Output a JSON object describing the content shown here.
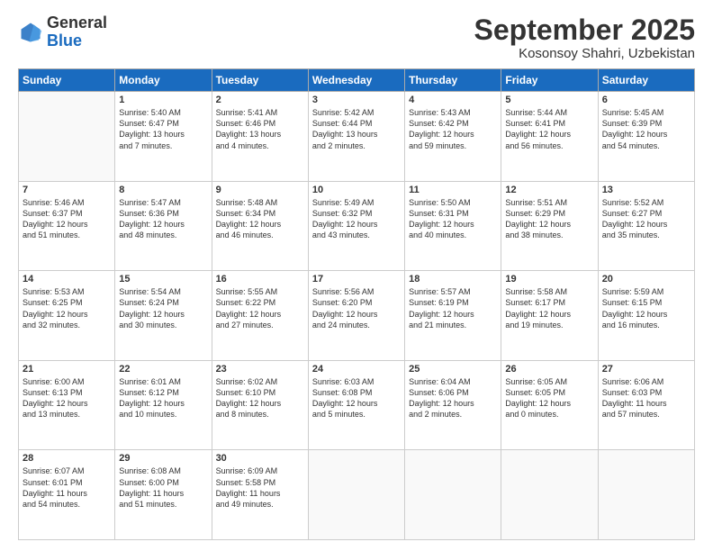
{
  "logo": {
    "general": "General",
    "blue": "Blue"
  },
  "header": {
    "month": "September 2025",
    "location": "Kosonsoy Shahri, Uzbekistan"
  },
  "weekdays": [
    "Sunday",
    "Monday",
    "Tuesday",
    "Wednesday",
    "Thursday",
    "Friday",
    "Saturday"
  ],
  "weeks": [
    [
      {
        "day": "",
        "info": ""
      },
      {
        "day": "1",
        "info": "Sunrise: 5:40 AM\nSunset: 6:47 PM\nDaylight: 13 hours\nand 7 minutes."
      },
      {
        "day": "2",
        "info": "Sunrise: 5:41 AM\nSunset: 6:46 PM\nDaylight: 13 hours\nand 4 minutes."
      },
      {
        "day": "3",
        "info": "Sunrise: 5:42 AM\nSunset: 6:44 PM\nDaylight: 13 hours\nand 2 minutes."
      },
      {
        "day": "4",
        "info": "Sunrise: 5:43 AM\nSunset: 6:42 PM\nDaylight: 12 hours\nand 59 minutes."
      },
      {
        "day": "5",
        "info": "Sunrise: 5:44 AM\nSunset: 6:41 PM\nDaylight: 12 hours\nand 56 minutes."
      },
      {
        "day": "6",
        "info": "Sunrise: 5:45 AM\nSunset: 6:39 PM\nDaylight: 12 hours\nand 54 minutes."
      }
    ],
    [
      {
        "day": "7",
        "info": "Sunrise: 5:46 AM\nSunset: 6:37 PM\nDaylight: 12 hours\nand 51 minutes."
      },
      {
        "day": "8",
        "info": "Sunrise: 5:47 AM\nSunset: 6:36 PM\nDaylight: 12 hours\nand 48 minutes."
      },
      {
        "day": "9",
        "info": "Sunrise: 5:48 AM\nSunset: 6:34 PM\nDaylight: 12 hours\nand 46 minutes."
      },
      {
        "day": "10",
        "info": "Sunrise: 5:49 AM\nSunset: 6:32 PM\nDaylight: 12 hours\nand 43 minutes."
      },
      {
        "day": "11",
        "info": "Sunrise: 5:50 AM\nSunset: 6:31 PM\nDaylight: 12 hours\nand 40 minutes."
      },
      {
        "day": "12",
        "info": "Sunrise: 5:51 AM\nSunset: 6:29 PM\nDaylight: 12 hours\nand 38 minutes."
      },
      {
        "day": "13",
        "info": "Sunrise: 5:52 AM\nSunset: 6:27 PM\nDaylight: 12 hours\nand 35 minutes."
      }
    ],
    [
      {
        "day": "14",
        "info": "Sunrise: 5:53 AM\nSunset: 6:25 PM\nDaylight: 12 hours\nand 32 minutes."
      },
      {
        "day": "15",
        "info": "Sunrise: 5:54 AM\nSunset: 6:24 PM\nDaylight: 12 hours\nand 30 minutes."
      },
      {
        "day": "16",
        "info": "Sunrise: 5:55 AM\nSunset: 6:22 PM\nDaylight: 12 hours\nand 27 minutes."
      },
      {
        "day": "17",
        "info": "Sunrise: 5:56 AM\nSunset: 6:20 PM\nDaylight: 12 hours\nand 24 minutes."
      },
      {
        "day": "18",
        "info": "Sunrise: 5:57 AM\nSunset: 6:19 PM\nDaylight: 12 hours\nand 21 minutes."
      },
      {
        "day": "19",
        "info": "Sunrise: 5:58 AM\nSunset: 6:17 PM\nDaylight: 12 hours\nand 19 minutes."
      },
      {
        "day": "20",
        "info": "Sunrise: 5:59 AM\nSunset: 6:15 PM\nDaylight: 12 hours\nand 16 minutes."
      }
    ],
    [
      {
        "day": "21",
        "info": "Sunrise: 6:00 AM\nSunset: 6:13 PM\nDaylight: 12 hours\nand 13 minutes."
      },
      {
        "day": "22",
        "info": "Sunrise: 6:01 AM\nSunset: 6:12 PM\nDaylight: 12 hours\nand 10 minutes."
      },
      {
        "day": "23",
        "info": "Sunrise: 6:02 AM\nSunset: 6:10 PM\nDaylight: 12 hours\nand 8 minutes."
      },
      {
        "day": "24",
        "info": "Sunrise: 6:03 AM\nSunset: 6:08 PM\nDaylight: 12 hours\nand 5 minutes."
      },
      {
        "day": "25",
        "info": "Sunrise: 6:04 AM\nSunset: 6:06 PM\nDaylight: 12 hours\nand 2 minutes."
      },
      {
        "day": "26",
        "info": "Sunrise: 6:05 AM\nSunset: 6:05 PM\nDaylight: 12 hours\nand 0 minutes."
      },
      {
        "day": "27",
        "info": "Sunrise: 6:06 AM\nSunset: 6:03 PM\nDaylight: 11 hours\nand 57 minutes."
      }
    ],
    [
      {
        "day": "28",
        "info": "Sunrise: 6:07 AM\nSunset: 6:01 PM\nDaylight: 11 hours\nand 54 minutes."
      },
      {
        "day": "29",
        "info": "Sunrise: 6:08 AM\nSunset: 6:00 PM\nDaylight: 11 hours\nand 51 minutes."
      },
      {
        "day": "30",
        "info": "Sunrise: 6:09 AM\nSunset: 5:58 PM\nDaylight: 11 hours\nand 49 minutes."
      },
      {
        "day": "",
        "info": ""
      },
      {
        "day": "",
        "info": ""
      },
      {
        "day": "",
        "info": ""
      },
      {
        "day": "",
        "info": ""
      }
    ]
  ]
}
